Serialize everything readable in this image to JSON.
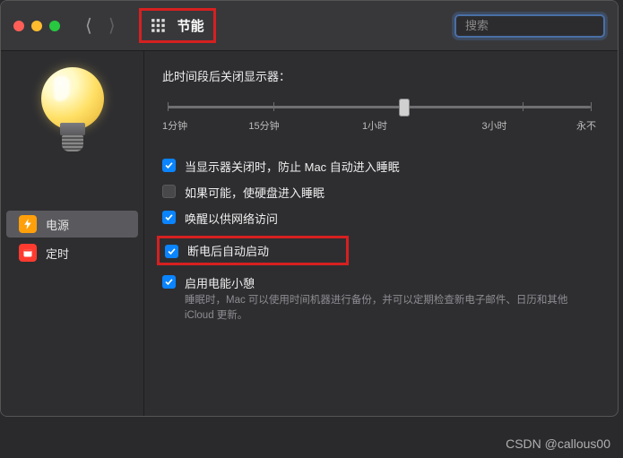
{
  "header": {
    "title": "节能",
    "search_placeholder": "搜索"
  },
  "sidebar": {
    "items": [
      {
        "label": "电源",
        "icon": "bolt",
        "selected": true
      },
      {
        "label": "定时",
        "icon": "calendar",
        "selected": false
      }
    ]
  },
  "slider": {
    "title": "此时间段后关闭显示器：",
    "ticks": [
      "1分钟",
      "15分钟",
      "1小时",
      "3小时",
      "永不"
    ],
    "value_fraction": 0.56
  },
  "options": [
    {
      "label": "当显示器关闭时，防止 Mac 自动进入睡眠",
      "checked": true
    },
    {
      "label": "如果可能，使硬盘进入睡眠",
      "checked": false
    },
    {
      "label": "唤醒以供网络访问",
      "checked": true
    },
    {
      "label": "断电后自动启动",
      "checked": true,
      "highlighted": true
    },
    {
      "label": "启用电能小憩",
      "checked": true,
      "desc": "睡眠时，Mac 可以使用时间机器进行备份，并可以定期检查新电子邮件、日历和其他 iCloud 更新。"
    }
  ],
  "watermark": "CSDN @callous00"
}
